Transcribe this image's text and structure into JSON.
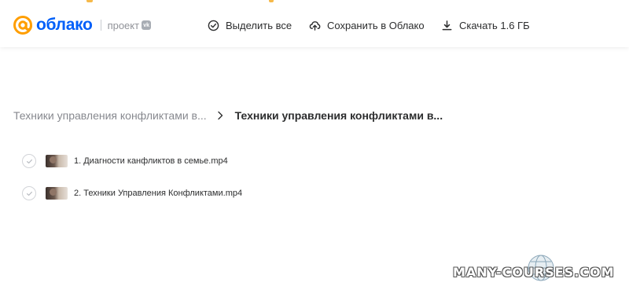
{
  "header": {
    "logo_text": "облако",
    "project_label": "проект",
    "vk_badge": "vk",
    "brand_color": "#005ff9",
    "accent_color": "#f6b94a",
    "actions": [
      {
        "label": "Выделить все",
        "icon": "check-circle-icon"
      },
      {
        "label": "Сохранить в Облако",
        "icon": "cloud-upload-icon"
      },
      {
        "label": "Скачать 1.6 ГБ",
        "icon": "download-icon"
      }
    ]
  },
  "breadcrumb": {
    "parent": "Техники управления конфликтами в...",
    "separator_icon": "chevron-right-icon",
    "current": "Техники управления конфликтами в..."
  },
  "files": [
    {
      "name": "1. Диагности канфликтов в семье.mp4",
      "thumbnail": "video-thumbnail"
    },
    {
      "name": "2. Техники Управления Конфликтами.mp4",
      "thumbnail": "video-thumbnail"
    }
  ],
  "watermark": {
    "text": "MANY-COURSES.COM"
  }
}
